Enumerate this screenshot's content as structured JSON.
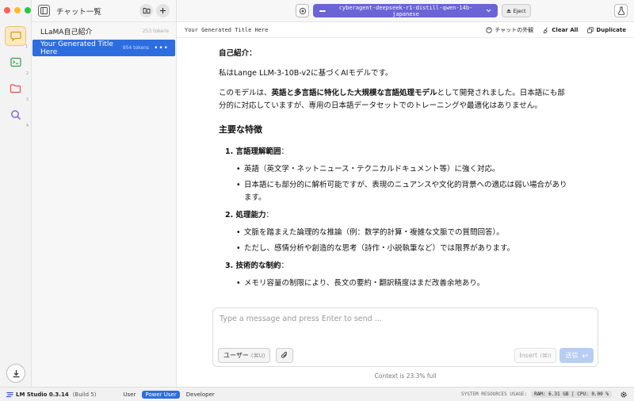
{
  "colors": {
    "accent": "#2e6ddf",
    "model_pill": "#6a64d6",
    "chat_active": "#f2c46f"
  },
  "sidebar": {
    "rail_items": [
      {
        "icon": "chat-icon",
        "num": "1"
      },
      {
        "icon": "terminal-icon",
        "num": "2"
      },
      {
        "icon": "folder-icon",
        "num": "3"
      },
      {
        "icon": "search-icon",
        "num": "4"
      }
    ]
  },
  "chatlist": {
    "title": "チャット一覧",
    "items": [
      {
        "label": "LLaMA自己紹介",
        "tokens": "253 tokens"
      },
      {
        "label": "Your Generated Title Here",
        "tokens": "954 tokens",
        "menu": "•••"
      }
    ]
  },
  "topbar": {
    "model": "cyberagent-deepseek-r1-distill-qwen-14b-japanese",
    "eject": "Eject"
  },
  "subbar": {
    "chat_title": "Your Generated Title Here",
    "appearance": "チャットの外観",
    "clear": "Clear All",
    "duplicate": "Duplicate"
  },
  "message": {
    "heading1": "自己紹介：",
    "p1": "私はLange LLM-3-10B-v2に基づくAIモデルです。",
    "p2_pre": "このモデルは、",
    "p2_bold": "英語と多言語に特化した大規模な言語処理モデル",
    "p2_post": "として開発されました。日本語にも部分的に対応していますが、専用の日本語データセットでのトレーニングや最適化はありません。",
    "heading2": "主要な特徴",
    "sections": [
      {
        "head": "1. 言語理解範囲",
        "suffix": "：",
        "bullets": [
          "英語（英文学・ネットニュース・テクニカルドキュメント等）に強く対応。",
          "日本語にも部分的に解析可能ですが、表現のニュアンスや文化的背景への適応は弱い場合があります。"
        ]
      },
      {
        "head": "2. 処理能力",
        "suffix": "：",
        "bullets": [
          "文脈を踏まえた論理的な推論（例：数学的計算・複雑な文脈での質問回答）。",
          "ただし、感情分析や創造的な思考（詩作・小説執筆など）では限界があります。"
        ]
      },
      {
        "head": "3. 技術的な制約",
        "suffix": "：",
        "bullets": [
          "メモリ容量の制限により、長文の要約・翻訳精度はまだ改善余地あり。"
        ]
      }
    ]
  },
  "composer": {
    "placeholder": "Type a message and press Enter to send ...",
    "role": "ユーザー",
    "role_kbd": "(⌘U)",
    "insert": "Insert",
    "insert_kbd": "(⌘I)",
    "send": "送信",
    "context": "Context is 23.3% full"
  },
  "statusbar": {
    "app": "LM Studio 0.3.14",
    "build": "(Build 5)",
    "modes": [
      "User",
      "Power User",
      "Developer"
    ],
    "active_mode": "Power User",
    "sys_label": "SYSTEM RESOURCES USAGE:",
    "sys_vals": "RAM: 6.31 GB  |  CPU: 0.00 %"
  }
}
